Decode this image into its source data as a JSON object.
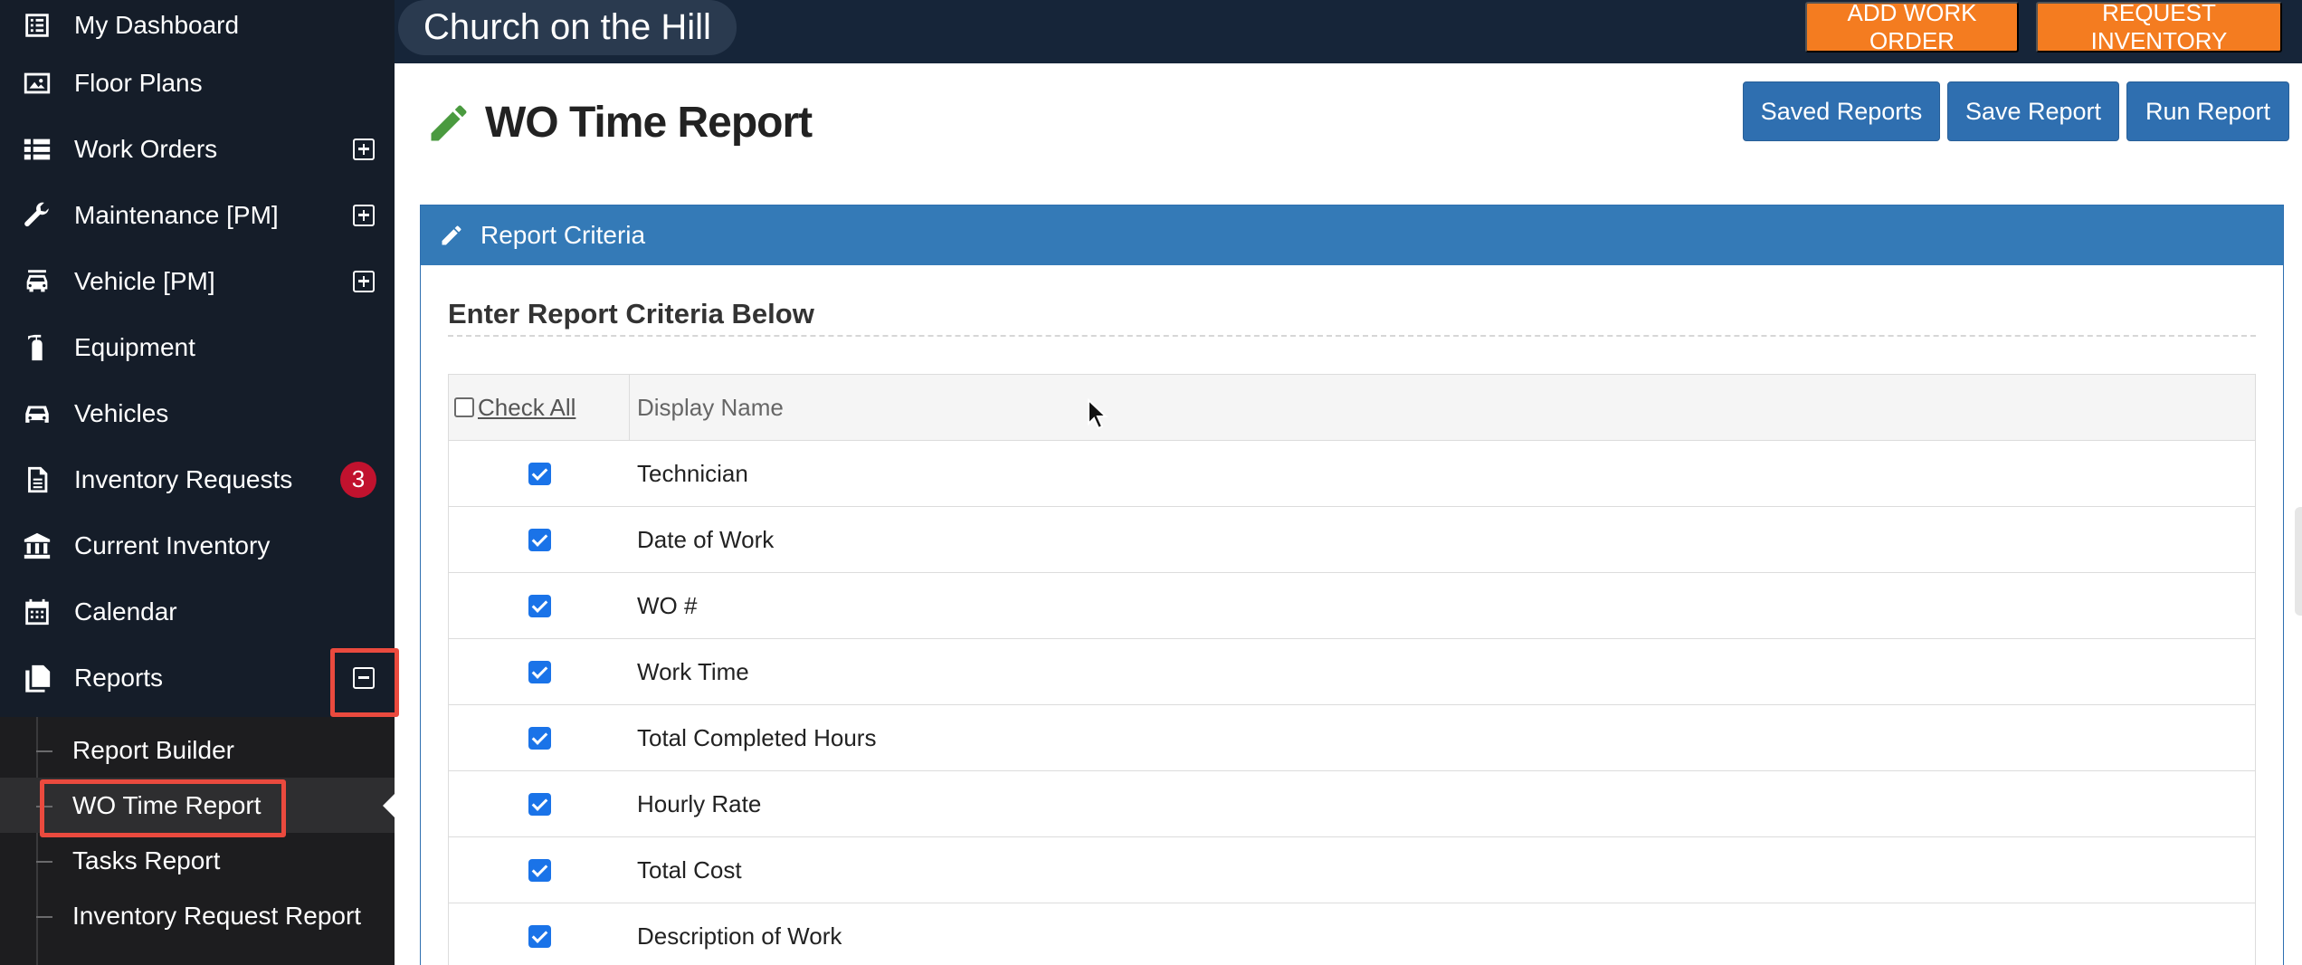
{
  "sidebar": {
    "items": [
      {
        "label": "My Dashboard",
        "icon": "list-icon"
      },
      {
        "label": "Floor Plans",
        "icon": "image-icon"
      },
      {
        "label": "Work Orders",
        "icon": "list-grid-icon"
      },
      {
        "label": "Maintenance [PM]",
        "icon": "wrench-icon"
      },
      {
        "label": "Vehicle [PM]",
        "icon": "car-service-icon"
      },
      {
        "label": "Equipment",
        "icon": "fire-extinguisher-icon"
      },
      {
        "label": "Vehicles",
        "icon": "car-icon"
      },
      {
        "label": "Inventory Requests",
        "icon": "document-icon",
        "badge": "3"
      },
      {
        "label": "Current Inventory",
        "icon": "bank-icon"
      },
      {
        "label": "Calendar",
        "icon": "calendar-icon"
      },
      {
        "label": "Reports",
        "icon": "copy-icon"
      }
    ],
    "reports_submenu": [
      {
        "label": "Report Builder"
      },
      {
        "label": "WO Time Report"
      },
      {
        "label": "Tasks Report"
      },
      {
        "label": "Inventory Request Report"
      }
    ]
  },
  "topbar": {
    "site_name": "Church on the Hill",
    "add_work_order": "ADD WORK ORDER",
    "request_inventory": "REQUEST INVENTORY"
  },
  "page": {
    "title": "WO Time Report",
    "saved_reports": "Saved Reports",
    "save_report": "Save Report",
    "run_report": "Run Report"
  },
  "panel": {
    "heading": "Report Criteria",
    "subheading": "Enter Report Criteria Below",
    "check_all": "Check All",
    "display_name_header": "Display Name",
    "rows": [
      {
        "label": "Technician",
        "checked": true
      },
      {
        "label": "Date of Work",
        "checked": true
      },
      {
        "label": "WO #",
        "checked": true
      },
      {
        "label": "Work Time",
        "checked": true
      },
      {
        "label": "Total Completed Hours",
        "checked": true
      },
      {
        "label": "Hourly Rate",
        "checked": true
      },
      {
        "label": "Total Cost",
        "checked": true
      },
      {
        "label": "Description of Work",
        "checked": true
      }
    ]
  },
  "colors": {
    "sidebar_bg": "#151d29",
    "topbar_bg": "#162539",
    "accent_orange": "#f47c20",
    "primary_blue": "#2f6fb0",
    "badge_red": "#c1122e",
    "highlight_red": "#ea4a3e",
    "pencil_green": "#4a9a3f"
  }
}
